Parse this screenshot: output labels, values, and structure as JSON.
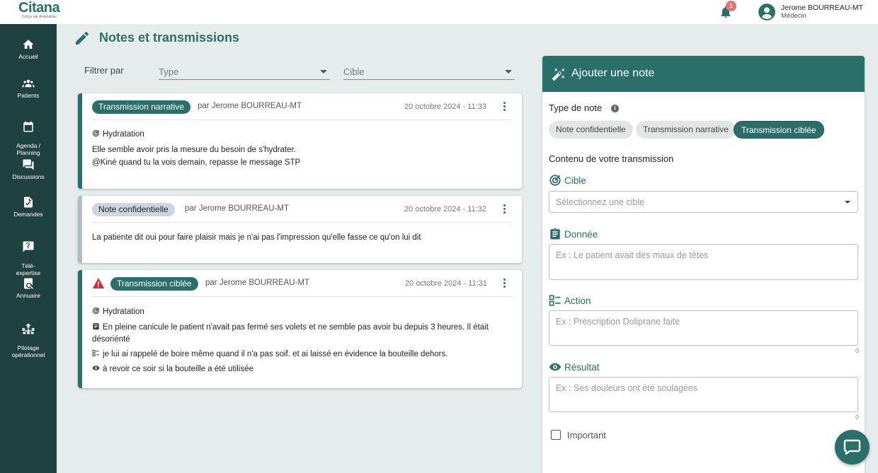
{
  "header": {
    "logo_name": "Citana",
    "logo_tagline": "Conçu par Arsenalizer",
    "notification_count": "1",
    "user_name": "Jerome BOURREAU-MT",
    "user_role": "Médecin"
  },
  "sidebar": {
    "items": [
      {
        "label": "Accueil",
        "icon": "home-icon"
      },
      {
        "label": "Patients",
        "icon": "people-icon"
      },
      {
        "label": "Agenda /\nPlanning",
        "icon": "calendar-icon"
      },
      {
        "label": "Discussions",
        "icon": "chat-icon"
      },
      {
        "label": "Demandes",
        "icon": "document-icon"
      },
      {
        "label": "Télé-\nexpertise",
        "icon": "question-icon"
      },
      {
        "label": "Annuaire",
        "icon": "directory-icon"
      },
      {
        "label": "Pilotage\nopérationnel",
        "icon": "network-icon"
      }
    ]
  },
  "page": {
    "title": "Notes et transmissions"
  },
  "filters": {
    "label": "Filtrer par",
    "type_placeholder": "Type",
    "cible_placeholder": "Cible"
  },
  "notes": [
    {
      "type": "Transmission narrative",
      "author": "par Jerome BOURREAU-MT",
      "date": "20 octobre 2024 - 11:33",
      "target": "Hydratation",
      "lines": [
        "Elle semble avoir pris la mesure du besoin de s'hydrater.",
        "@Kiné quand tu la vois demain, repasse le message STP"
      ]
    },
    {
      "type": "Note confidentielle",
      "author": "par Jerome BOURREAU-MT",
      "date": "20 octobre 2024 - 11:32",
      "lines": [
        "La patiente dit oui pour faire plaisir mais je n'ai pas l'impression qu'elle fasse ce qu'on lui dit"
      ]
    },
    {
      "type": "Transmission ciblée",
      "author": "par Jerome BOURREAU-MT",
      "date": "20 octobre 2024 - 11:31",
      "target": "Hydratation",
      "donnee_1": "En pleine canicule le patient n'avait pas fermé ses volets et ne semble pas avoir bu depuis 3 heures. Il était",
      "donnee_2": "désoriénté",
      "action": "je lui ai rappelé de boire même quand il n'a pas soif. et ai laissé en évidence la bouteille dehors.",
      "resultat": "à revoir ce soir si la bouteille a été utilisée"
    }
  ],
  "panel": {
    "title": "Ajouter une note",
    "type_label": "Type de note",
    "type_options": [
      "Note confidentielle",
      "Transmission narrative",
      "Transmission ciblée"
    ],
    "selected_type": "Transmission ciblée",
    "content_label": "Contenu de votre transmission",
    "cible_label": "Cible",
    "cible_placeholder": "Sélectionnez une cible",
    "donnee_label": "Donnée",
    "donnee_placeholder": "Ex : Le patient avait des maux de têtes",
    "action_label": "Action",
    "action_placeholder": "Ex : Prescription Doliprane faite",
    "action_count": "0",
    "resultat_label": "Résultat",
    "resultat_placeholder": "Ex : Ses douleurs ont été soulagées",
    "resultat_count": "0",
    "important_label": "Important"
  },
  "colors": {
    "accent": "#2b6f6a",
    "sidebar": "#1f4240",
    "confidential": "#b0bccb",
    "warning": "#d32f2f"
  }
}
